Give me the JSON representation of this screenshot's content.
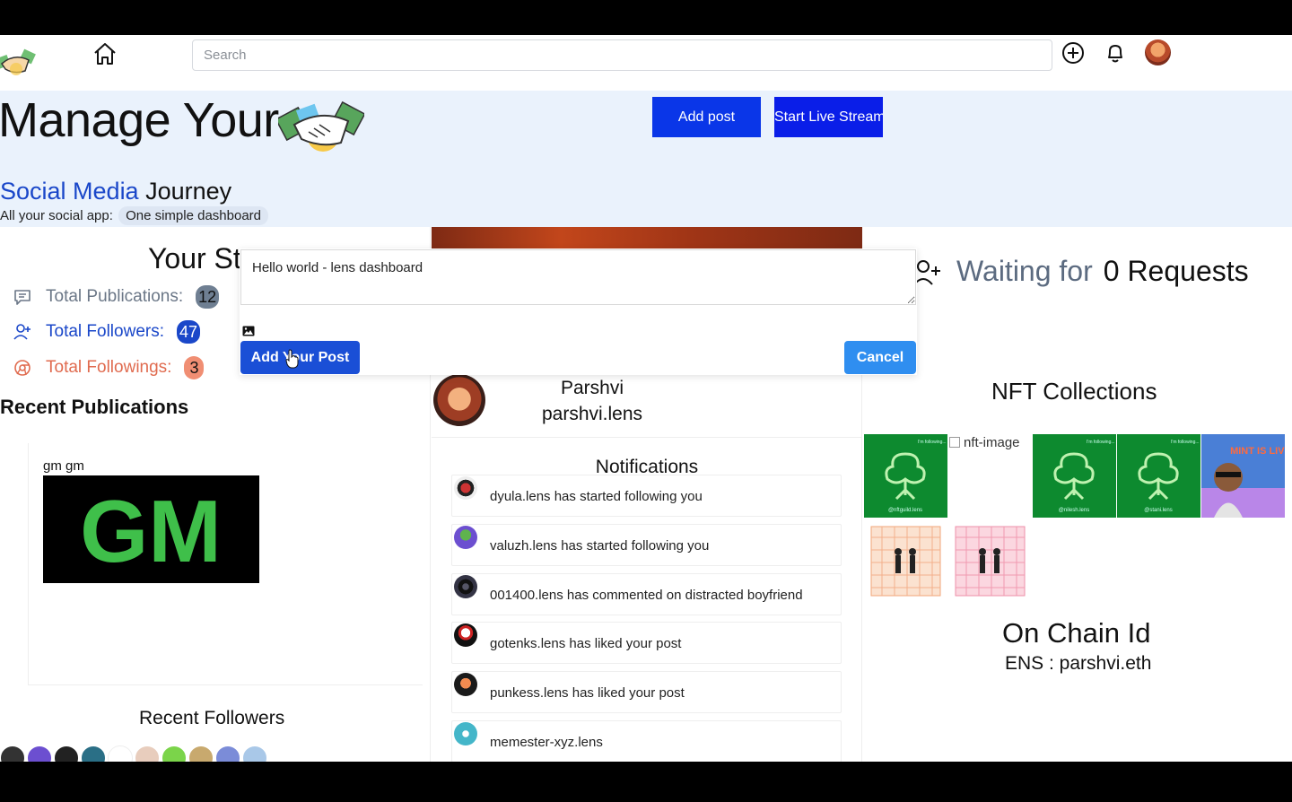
{
  "nav": {
    "search_placeholder": "Search",
    "icons": [
      "handshake-logo-icon",
      "home-icon",
      "plus-circle-icon",
      "bell-icon",
      "avatar"
    ]
  },
  "hero": {
    "title": "Manage Your",
    "subtitle_highlight": "Social Media",
    "subtitle_rest": "Journey",
    "tag_label": "All your social app:",
    "tag_pill": "One simple dashboard",
    "add_post": "Add post",
    "live_stream": "Start Live Stream"
  },
  "stats": {
    "title": "Your Stats",
    "items": [
      {
        "label": "Total Publications:",
        "value": "12",
        "color": "#6b7787",
        "badge_bg": "#6f7f92",
        "icon": "comment-icon"
      },
      {
        "label": "Total Followers:",
        "value": "47",
        "color": "#1a47c9",
        "badge_bg": "#1a47c9",
        "icon": "user-plus-icon"
      },
      {
        "label": "Total Followings:",
        "value": "3",
        "color": "#e06b4f",
        "badge_bg": "#f08e73",
        "icon": "chrome-icon"
      }
    ]
  },
  "recent_publications": {
    "title": "Recent Publications",
    "post_text": "gm gm",
    "image_text": "GM"
  },
  "recent_followers": {
    "title": "Recent Followers"
  },
  "modal": {
    "textarea_value": "Hello world - lens dashboard",
    "add_button": "Add Your Post",
    "cancel_button": "Cancel"
  },
  "profile": {
    "name": "Parshvi",
    "handle": "parshvi.lens"
  },
  "notifications": {
    "title": "Notifications",
    "items": [
      {
        "text": "dyula.lens has started following you"
      },
      {
        "text": "valuzh.lens has started following you"
      },
      {
        "text": "001400.lens has commented on distracted boyfriend"
      },
      {
        "text": "gotenks.lens has liked your post"
      },
      {
        "text": "punkess.lens has liked your post"
      },
      {
        "text": "memester-xyz.lens"
      }
    ]
  },
  "requests": {
    "prefix": "Waiting for",
    "count_text": "0 Requests"
  },
  "nft": {
    "title": "NFT Collections",
    "broken_alt": "nft-image",
    "card_caption_1": "I'm following...",
    "card_handle_1": "@nftguild.lens",
    "card_handle_2": "@nilesh.lens",
    "card_handle_3": "@stani.lens",
    "card_banner": "MINT IS LIVE"
  },
  "chain": {
    "title": "On Chain Id",
    "ens": "ENS : parshvi.eth"
  }
}
